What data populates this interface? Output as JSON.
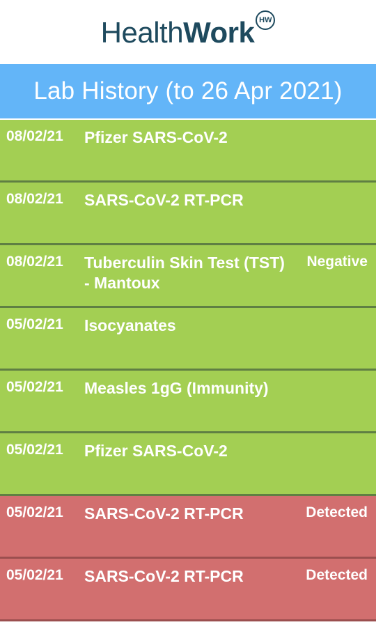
{
  "brand": {
    "logo_light": "Health",
    "logo_bold": "Work",
    "logo_badge": "HW"
  },
  "header": {
    "title": "Lab History (to 26 Apr 2021)"
  },
  "lab_results": [
    {
      "date": "08/02/21",
      "test": "Pfizer SARS-CoV-2",
      "result": "",
      "status": "normal"
    },
    {
      "date": "08/02/21",
      "test": "SARS-CoV-2 RT-PCR",
      "result": "",
      "status": "normal"
    },
    {
      "date": "08/02/21",
      "test": "Tuberculin Skin Test (TST) - Mantoux",
      "result": "Negative",
      "status": "normal"
    },
    {
      "date": "05/02/21",
      "test": "Isocyanates",
      "result": "",
      "status": "normal"
    },
    {
      "date": "05/02/21",
      "test": "Measles 1gG (Immunity)",
      "result": "",
      "status": "normal"
    },
    {
      "date": "05/02/21",
      "test": "Pfizer SARS-CoV-2",
      "result": "",
      "status": "normal"
    },
    {
      "date": "05/02/21",
      "test": "SARS-CoV-2 RT-PCR",
      "result": "Detected",
      "status": "alert"
    },
    {
      "date": "05/02/21",
      "test": "SARS-CoV-2 RT-PCR",
      "result": "Detected",
      "status": "alert"
    }
  ],
  "colors": {
    "header_bg": "#63b5f8",
    "normal_row": "#a3cf53",
    "alert_row": "#d26f6f",
    "brand_text": "#1e4a5e"
  }
}
